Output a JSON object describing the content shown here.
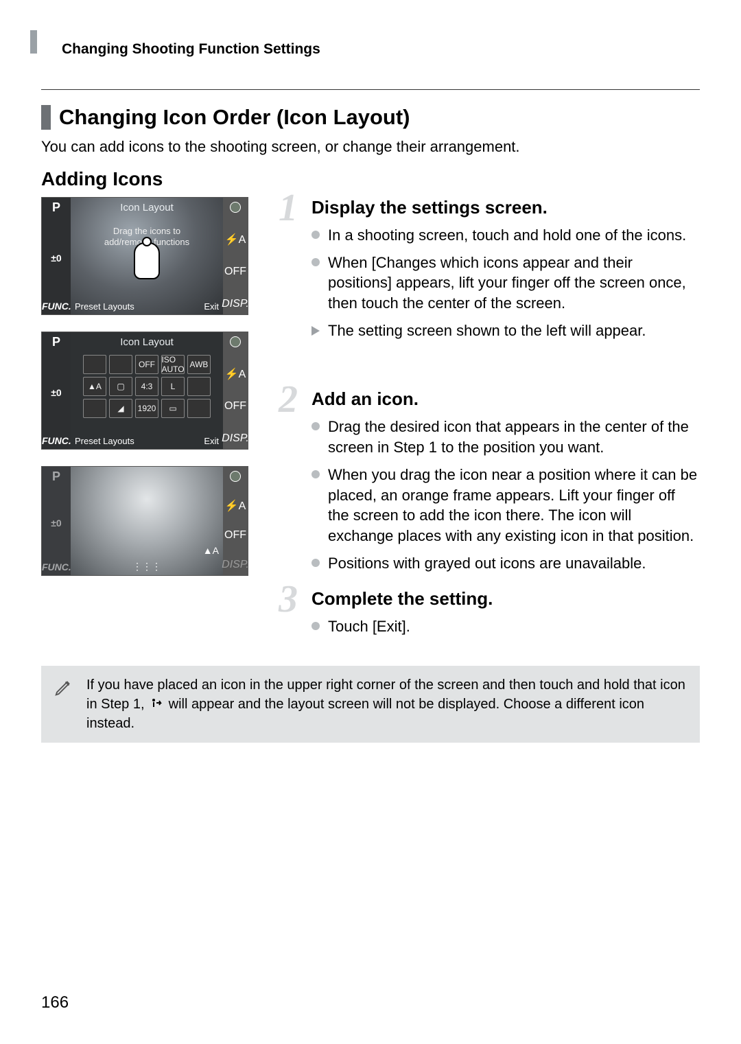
{
  "header": {
    "running": "Changing Shooting Function Settings"
  },
  "section": {
    "title": "Changing Icon Order (Icon Layout)",
    "intro": "You can add icons to the shooting screen, or change their arrangement.",
    "subsection": "Adding Icons"
  },
  "screenshots": {
    "s1": {
      "title": "Icon Layout",
      "drag_line1": "Drag the icons to",
      "drag_line2": "add/remove functions",
      "bottom_left": "Preset Layouts",
      "bottom_right": "Exit",
      "left_p": "P",
      "left_ev": "±0",
      "left_func": "FUNC.",
      "right_flash": "⚡A",
      "right_off": "OFF",
      "right_disp": "DISP."
    },
    "s2": {
      "title": "Icon Layout",
      "bottom_left": "Preset Layouts",
      "bottom_right": "Exit",
      "left_p": "P",
      "left_ev": "±0",
      "left_func": "FUNC.",
      "right_flash": "⚡A",
      "right_off": "OFF",
      "right_disp": "DISP.",
      "icons": [
        "",
        "",
        "OFF",
        "ISO AUTO",
        "AWB",
        "▲A",
        "▢",
        "4:3",
        "L",
        "",
        "",
        "◢",
        "1920",
        "▭",
        ""
      ]
    },
    "s3": {
      "left_p": "P",
      "left_ev": "±0",
      "right_flash": "⚡A",
      "right_off": "OFF",
      "right_disp": "DISP.",
      "drag_icon": "▲A"
    }
  },
  "steps": [
    {
      "num": "1",
      "title": "Display the settings screen.",
      "bullets": [
        {
          "type": "circle",
          "text": "In a shooting screen, touch and hold one of the icons."
        },
        {
          "type": "circle",
          "text": "When [Changes which icons appear and their positions] appears, lift your finger off the screen once, then touch the center of the screen."
        },
        {
          "type": "arrow",
          "text": "The setting screen shown to the left will appear."
        }
      ]
    },
    {
      "num": "2",
      "title": "Add an icon.",
      "bullets": [
        {
          "type": "circle",
          "text": "Drag the desired icon that appears in the center of the screen in Step 1 to the position you want."
        },
        {
          "type": "circle",
          "text": "When you drag the icon near a position where it can be placed, an orange frame appears. Lift your finger off the screen to add the icon there. The icon will exchange places with any existing icon in that position."
        },
        {
          "type": "circle",
          "text": "Positions with grayed out icons are unavailable."
        }
      ]
    },
    {
      "num": "3",
      "title": "Complete the setting.",
      "bullets": [
        {
          "type": "circle",
          "text": "Touch [Exit]."
        }
      ]
    }
  ],
  "note": {
    "before": "If you have placed an icon in the upper right corner of the screen and then touch and hold that icon in Step 1, ",
    "after": " will appear and the layout screen will not be displayed. Choose a different icon instead."
  },
  "page_number": "166"
}
